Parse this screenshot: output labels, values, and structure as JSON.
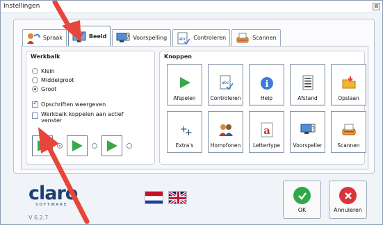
{
  "window": {
    "title": "Instellingen",
    "close_glyph": "⊠"
  },
  "tabs": [
    {
      "label": "Spraak",
      "icon": "speaker-person-icon"
    },
    {
      "label": "Beeld",
      "icon": "monitor-check-icon",
      "active": true
    },
    {
      "label": "Voorspelling",
      "icon": "monitor-question-icon"
    },
    {
      "label": "Controleren",
      "icon": "abc-check-icon"
    },
    {
      "label": "Scannen",
      "icon": "scanner-icon"
    }
  ],
  "werkbalk": {
    "title": "Werkbalk",
    "radios": [
      {
        "label": "Klein",
        "checked": false
      },
      {
        "label": "Middelgroot",
        "checked": false
      },
      {
        "label": "Groot",
        "checked": true
      }
    ],
    "checkboxes": [
      {
        "label": "Opschriften weergeven",
        "checked": true
      },
      {
        "label": "Werkbalk koppelen aan actief venster",
        "checked": false
      }
    ]
  },
  "knoppen": {
    "title": "Knoppen",
    "buttons": [
      {
        "label": "Afspelen",
        "icon": "play-icon"
      },
      {
        "label": "Controleren",
        "icon": "abc-check-icon"
      },
      {
        "label": "Help",
        "icon": "help-icon"
      },
      {
        "label": "Afstand",
        "icon": "line-spacing-icon"
      },
      {
        "label": "Opslaan",
        "icon": "save-folder-icon"
      },
      {
        "label": "Extra's",
        "icon": "plus-icon"
      },
      {
        "label": "Homofonen",
        "icon": "homophones-icon"
      },
      {
        "label": "Lettertype",
        "icon": "font-icon"
      },
      {
        "label": "Voorspeller",
        "icon": "monitor-question-icon"
      },
      {
        "label": "Scannen",
        "icon": "scanner-icon"
      }
    ]
  },
  "footer": {
    "logo_text": "claro",
    "logo_sub": "SOFTWARE",
    "version": "V 6.2.7",
    "ok_label": "OK",
    "cancel_label": "Annuleren"
  },
  "colors": {
    "accent_blue": "#1d3f75",
    "play_green": "#3aa84a",
    "ok_green": "#2fa84a",
    "cancel_red": "#d9343a",
    "arrow_red": "#e8453c"
  }
}
